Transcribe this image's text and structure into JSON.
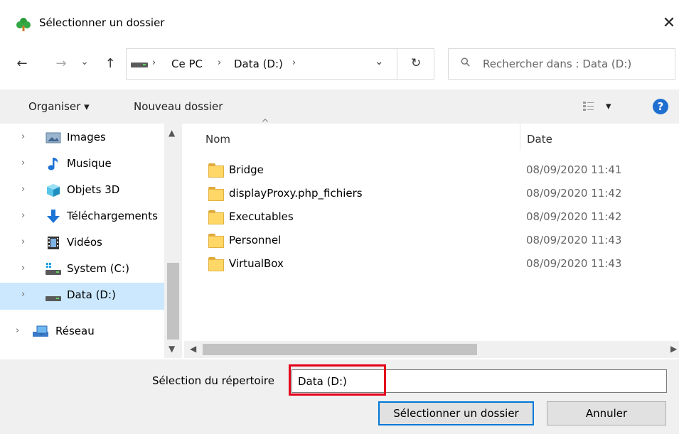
{
  "window": {
    "title": "Sélectionner un dossier",
    "close_glyph": "✕"
  },
  "nav": {
    "back_glyph": "←",
    "forward_glyph": "→",
    "recent_glyph": "⌄",
    "up_glyph": "↑",
    "address": {
      "crumbs": [
        "Ce PC",
        "Data (D:)"
      ],
      "separator": "›",
      "dropdown_glyph": "⌄",
      "refresh_glyph": "↻"
    },
    "search": {
      "placeholder": "Rechercher dans : Data (D:)",
      "icon_glyph": "⚲"
    }
  },
  "toolbar": {
    "organize": "Organiser ▾",
    "new_folder": "Nouveau dossier",
    "view_glyph": "▾",
    "help_glyph": "?"
  },
  "sidebar": {
    "items": [
      {
        "label": "Images",
        "icon": "pictures-icon"
      },
      {
        "label": "Musique",
        "icon": "music-icon"
      },
      {
        "label": "Objets 3D",
        "icon": "objects3d-icon"
      },
      {
        "label": "Téléchargements",
        "icon": "downloads-icon"
      },
      {
        "label": "Vidéos",
        "icon": "videos-icon"
      },
      {
        "label": "System (C:)",
        "icon": "system-drive-icon"
      },
      {
        "label": "Data (D:)",
        "icon": "drive-icon",
        "selected": true
      },
      {
        "label": "Réseau",
        "icon": "network-icon"
      }
    ],
    "chevron": "›"
  },
  "files": {
    "columns": {
      "name": "Nom",
      "date": "Date"
    },
    "rows": [
      {
        "name": "Bridge",
        "date": "08/09/2020 11:41"
      },
      {
        "name": "displayProxy.php_fichiers",
        "date": "08/09/2020 11:42"
      },
      {
        "name": "Executables",
        "date": "08/09/2020 11:42"
      },
      {
        "name": "Personnel",
        "date": "08/09/2020 11:43"
      },
      {
        "name": "VirtualBox",
        "date": "08/09/2020 11:43"
      }
    ]
  },
  "footer": {
    "label": "Sélection du répertoire",
    "value": "Data (D:)",
    "select_button": "Sélectionner un dossier",
    "cancel_button": "Annuler"
  },
  "colors": {
    "selection": "#cce8ff",
    "accent": "#0078d7",
    "highlight": "#e3001b"
  }
}
